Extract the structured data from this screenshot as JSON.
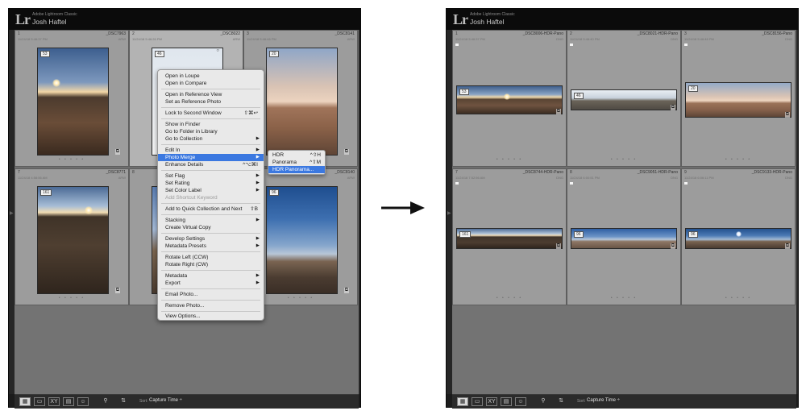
{
  "app": {
    "logo": "Lr",
    "app_name": "Adobe Lightroom Classic",
    "user_name": "Josh Haftel"
  },
  "left_grid": {
    "cells": [
      {
        "index": "1",
        "date": "11/24/18 5:46:37 PM",
        "name": "_DSC7963",
        "ext": "ARW",
        "rating": "53",
        "dots": "• • • • •"
      },
      {
        "index": "2",
        "date": "11/24/18 5:46:26 PM",
        "name": "_DSC8022",
        "ext": "ARW",
        "rating": "46",
        "dots": "• • • • •"
      },
      {
        "index": "3",
        "date": "11/24/18 5:46:46 PM",
        "name": "_DSC8141",
        "ext": "ARW",
        "rating": "20",
        "dots": "• • • • •"
      },
      {
        "index": "7",
        "date": "11/24/18 4:58:56 AM",
        "name": "_DSC8771",
        "ext": "ARW",
        "rating": "161",
        "dots": "• • • • •"
      },
      {
        "index": "8",
        "date": "",
        "name": "",
        "ext": "ARW",
        "rating": "",
        "dots": "• • • • •"
      },
      {
        "index": "",
        "date": "",
        "name": "_DSC8140",
        "ext": "ARW",
        "rating": "96",
        "dots": "• • • • •"
      }
    ]
  },
  "right_grid": {
    "cells": [
      {
        "index": "1",
        "date": "11/24/18 5:46:37 PM",
        "name": "_DSC8006-HDR-Pano",
        "ext": "DNG",
        "rating": "53",
        "dots": "• • • • •"
      },
      {
        "index": "2",
        "date": "11/24/18 5:46:40 PM",
        "name": "_DSC8021-HDR-Pano",
        "ext": "DNG",
        "rating": "46",
        "dots": "• • • • •"
      },
      {
        "index": "3",
        "date": "11/24/18 5:46:46 PM",
        "name": "_DSC8156-Pano",
        "ext": "DNG",
        "rating": "20",
        "dots": "• • • • •"
      },
      {
        "index": "7",
        "date": "11/24/18 7:52:56 AM",
        "name": "_DSC8744-HDR-Pano",
        "ext": "DNG",
        "rating": "161",
        "dots": "• • • • •"
      },
      {
        "index": "8",
        "date": "11/24/18 6:00:51 PM",
        "name": "_DSC9051-HDR-Pano",
        "ext": "DNG",
        "rating": "96",
        "dots": "• • • • •"
      },
      {
        "index": "9",
        "date": "11/24/18 6:06:11 PM",
        "name": "_DSC9133-HDR-Pano",
        "ext": "DNG",
        "rating": "96",
        "dots": "• • • • •"
      }
    ]
  },
  "toolbar": {
    "sort_label": "Sort:",
    "sort_value": "Capture Time ÷"
  },
  "context_menu": {
    "items": [
      {
        "label": "Open in Loupe",
        "shortcut": ""
      },
      {
        "label": "Open in Compare",
        "shortcut": ""
      },
      {
        "label": "Open in Reference View",
        "shortcut": ""
      },
      {
        "label": "Set as Reference Photo",
        "shortcut": ""
      },
      {
        "label": "Lock to Second Window",
        "shortcut": "⇧⌘↩"
      },
      {
        "label": "Show in Finder",
        "shortcut": ""
      },
      {
        "label": "Go to Folder in Library",
        "shortcut": ""
      },
      {
        "label": "Go to Collection",
        "shortcut": "▶"
      },
      {
        "label": "Edit In",
        "shortcut": "▶"
      },
      {
        "label": "Photo Merge",
        "shortcut": "▶"
      },
      {
        "label": "Enhance Details",
        "shortcut": "^⌥⌘I"
      },
      {
        "label": "Set Flag",
        "shortcut": "▶"
      },
      {
        "label": "Set Rating",
        "shortcut": "▶"
      },
      {
        "label": "Set Color Label",
        "shortcut": "▶"
      },
      {
        "label": "Add Shortcut Keyword",
        "shortcut": ""
      },
      {
        "label": "Add to Quick Collection and Next",
        "shortcut": "⇧B"
      },
      {
        "label": "Stacking",
        "shortcut": "▶"
      },
      {
        "label": "Create Virtual Copy",
        "shortcut": ""
      },
      {
        "label": "Develop Settings",
        "shortcut": "▶"
      },
      {
        "label": "Metadata Presets",
        "shortcut": "▶"
      },
      {
        "label": "Rotate Left (CCW)",
        "shortcut": ""
      },
      {
        "label": "Rotate Right (CW)",
        "shortcut": ""
      },
      {
        "label": "Metadata",
        "shortcut": "▶"
      },
      {
        "label": "Export",
        "shortcut": "▶"
      },
      {
        "label": "Email Photo...",
        "shortcut": ""
      },
      {
        "label": "Remove Photo...",
        "shortcut": ""
      },
      {
        "label": "View Options...",
        "shortcut": ""
      }
    ]
  },
  "submenu": {
    "items": [
      {
        "label": "HDR",
        "shortcut": "^⇧H"
      },
      {
        "label": "Panorama",
        "shortcut": "^⇧M"
      },
      {
        "label": "HDR Panorama...",
        "shortcut": ""
      }
    ]
  },
  "colors": {
    "highlight": "#3b78e0",
    "grid_bg": "#6e6e6e",
    "cell_bg": "#9c9c9c"
  }
}
